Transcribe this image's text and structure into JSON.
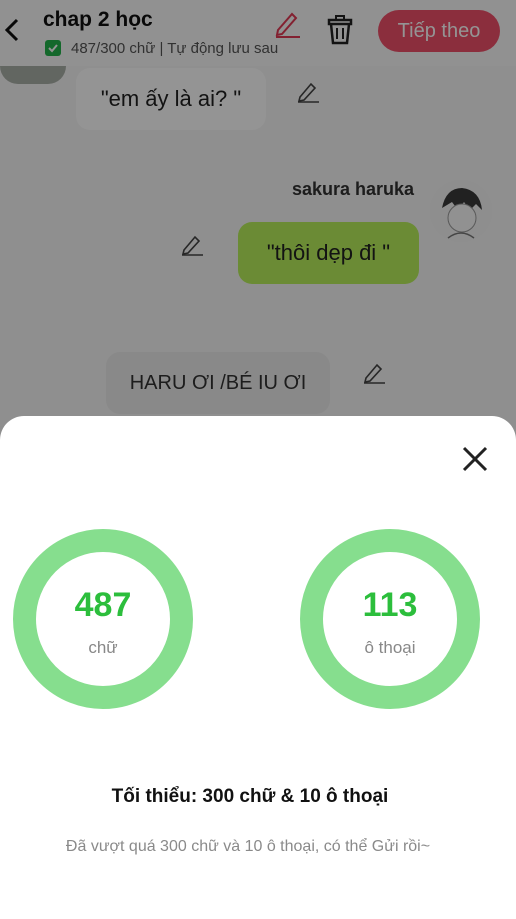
{
  "header": {
    "title": "chap 2 học",
    "status": "487/300 chữ | Tự động lưu sau",
    "next_label": "Tiếp theo",
    "back_icon": "chevron-left-icon",
    "edit_icon": "pencil-icon",
    "delete_icon": "trash-icon"
  },
  "messages": [
    {
      "text": "\"em ấy là ai? \"",
      "side": "left"
    },
    {
      "sender": "sakura haruka",
      "text": "\"thôi dẹp đi \"",
      "side": "right"
    },
    {
      "text": "HARU ƠI /BÉ IU ƠI",
      "side": "left"
    }
  ],
  "sheet": {
    "close_icon": "close-icon",
    "stats": [
      {
        "value": "487",
        "unit": "chữ"
      },
      {
        "value": "113",
        "unit": "ô thoại"
      }
    ],
    "minimum_text": "Tối thiểu: 300 chữ & 10 ô thoại",
    "note": "Đã vượt quá 300 chữ và 10 ô thoại, có thể Gửi rồi~"
  },
  "colors": {
    "accent": "#f0506a",
    "ring": "#86de8e",
    "stat_text": "#2cbe3c",
    "bubble_right": "#b8ef5c"
  }
}
